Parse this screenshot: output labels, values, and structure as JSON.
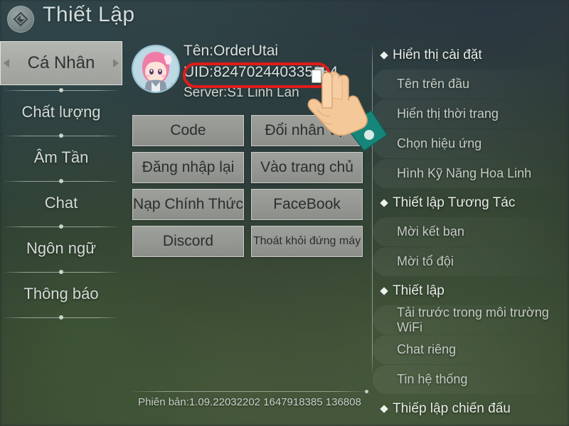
{
  "header": {
    "title": "Thiết Lập",
    "logo_icon": "diamond-badge-icon"
  },
  "sidebar": {
    "items": [
      {
        "label": "Cá Nhân",
        "active": true
      },
      {
        "label": "Chất lượng",
        "active": false
      },
      {
        "label": "Âm Tần",
        "active": false
      },
      {
        "label": "Chat",
        "active": false
      },
      {
        "label": "Ngôn ngữ",
        "active": false
      },
      {
        "label": "Thông báo",
        "active": false
      }
    ]
  },
  "profile": {
    "name_line": "Tên:OrderUtai",
    "uid_line": "UID:824702440335184",
    "uid_value": "824702440335184",
    "server_line": "Server:S1 Linh Lan",
    "copy_icon": "copy-icon",
    "refresh_icon": "refresh-icon",
    "avatar_icon": "player-avatar",
    "highlight_color": "#e11b1b"
  },
  "buttons": [
    {
      "label": "Code",
      "small": false
    },
    {
      "label": "Đổi nhân vật",
      "small": false
    },
    {
      "label": "Đăng nhập lại",
      "small": false
    },
    {
      "label": "Vào trang chủ",
      "small": false
    },
    {
      "label": "Nạp Chính Thức",
      "small": false
    },
    {
      "label": "FaceBook",
      "small": false
    },
    {
      "label": "Discord",
      "small": false
    },
    {
      "label": "Thoát khỏi đứng máy",
      "small": true
    }
  ],
  "footer": {
    "version": "Phiên bản:1.09.22032202 1647918385 136808"
  },
  "right_panel": {
    "groups": [
      {
        "title": "Hiển thị cài đặt",
        "items": [
          "Tên trên đầu",
          "Hiển thị thời trang",
          "Chọn hiệu ứng",
          "Hình Kỹ Năng Hoa Linh"
        ]
      },
      {
        "title": "Thiết lập Tương Tác",
        "items": [
          "Mời kết bạn",
          "Mời tổ đội"
        ]
      },
      {
        "title": "Thiết lập",
        "items": [
          "Tải trước trong môi trường WiFi",
          "Chat riêng",
          "Tin hệ thống"
        ]
      },
      {
        "title": "Thiếp lập chiến đấu",
        "items": []
      }
    ]
  },
  "cursor": {
    "icon": "pointing-hand-cursor",
    "skin_color": "#f5c89a",
    "sleeve_color": "#17867a"
  }
}
